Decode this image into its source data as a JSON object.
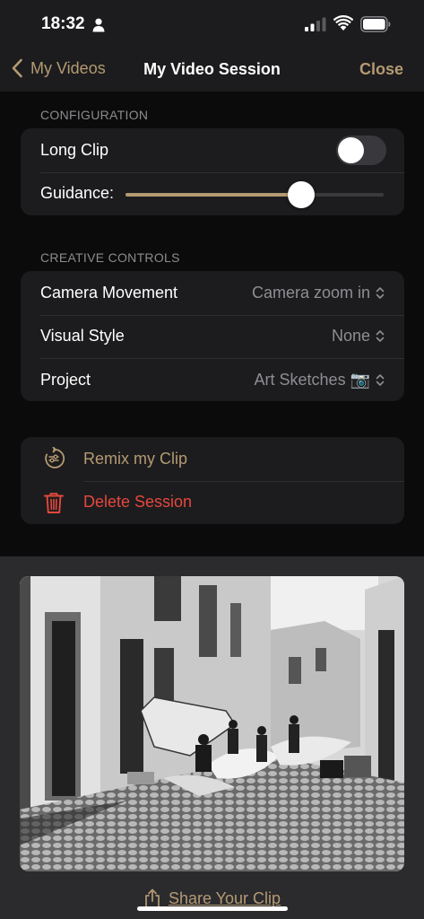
{
  "status_bar": {
    "time": "18:32"
  },
  "nav": {
    "back_label": "My Videos",
    "title": "My Video Session",
    "close_label": "Close"
  },
  "configuration": {
    "header": "CONFIGURATION",
    "long_clip": {
      "label": "Long Clip",
      "enabled": false
    },
    "guidance": {
      "label": "Guidance:",
      "value_fraction": 0.68
    }
  },
  "creative_controls": {
    "header": "CREATIVE CONTROLS",
    "rows": [
      {
        "label": "Camera Movement",
        "value": "Camera zoom in"
      },
      {
        "label": "Visual Style",
        "value": "None"
      },
      {
        "label": "Project",
        "value": "Art Sketches 📷"
      }
    ]
  },
  "actions": {
    "remix_label": "Remix my Clip",
    "delete_label": "Delete Session"
  },
  "share": {
    "label": "Share Your Clip"
  },
  "colors": {
    "accent": "#b49a72",
    "destructive": "#e5473d",
    "background": "#000000",
    "card": "#1c1c1e"
  }
}
